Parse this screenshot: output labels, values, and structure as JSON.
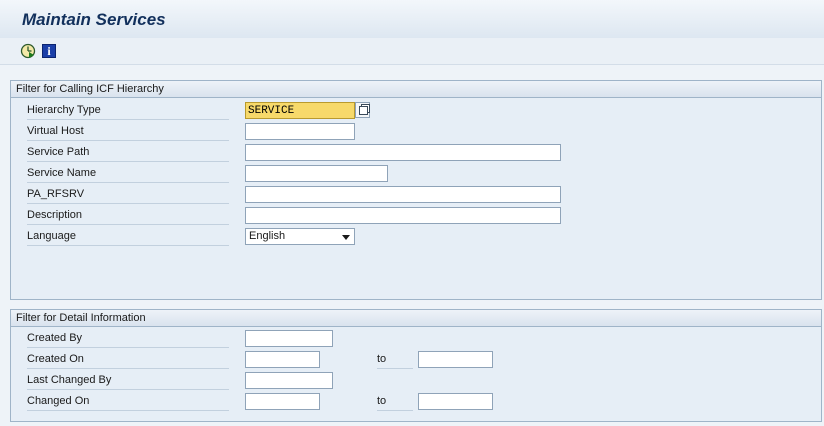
{
  "title": "Maintain Services",
  "toolbar": {
    "execute_icon": "execute-clock-icon",
    "info_icon": "info-icon",
    "info_glyph": "i"
  },
  "group1": {
    "title": "Filter for Calling ICF Hierarchy",
    "fields": {
      "hierarchy_type": {
        "label": "Hierarchy Type",
        "value": "SERVICE"
      },
      "virtual_host": {
        "label": "Virtual Host",
        "value": ""
      },
      "service_path": {
        "label": "Service Path",
        "value": ""
      },
      "service_name": {
        "label": "Service Name",
        "value": ""
      },
      "pa_rfsrv": {
        "label": "PA_RFSRV",
        "value": ""
      },
      "description": {
        "label": "Description",
        "value": ""
      },
      "language": {
        "label": "Language",
        "value": "English"
      }
    }
  },
  "group2": {
    "title": "Filter for Detail Information",
    "fields": {
      "created_by": {
        "label": "Created By",
        "value": ""
      },
      "created_on": {
        "label": "Created On",
        "value": "",
        "to_label": "to",
        "to_value": ""
      },
      "last_changed_by": {
        "label": "Last Changed By",
        "value": ""
      },
      "changed_on": {
        "label": "Changed On",
        "value": "",
        "to_label": "to",
        "to_value": ""
      }
    }
  },
  "colors": {
    "title_text": "#12305c",
    "highlight": "#f7d96a",
    "group_bg": "#e6eef6",
    "border": "#9fb4c8"
  }
}
